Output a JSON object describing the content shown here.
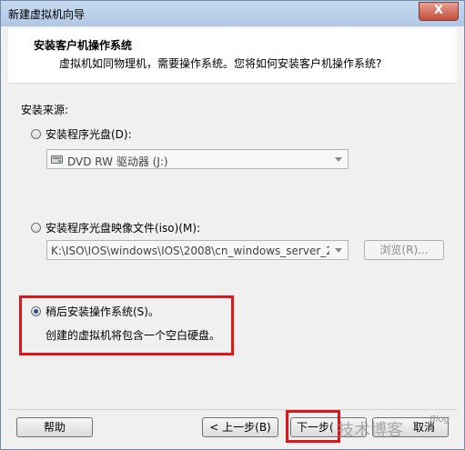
{
  "window": {
    "title": "新建虚拟机向导",
    "close_label": "X"
  },
  "header": {
    "title": "安装客户机操作系统",
    "subtitle": "虚拟机如同物理机，需要操作系统。您将如何安装客户机操作系统?"
  },
  "install_source": {
    "label": "安装来源:",
    "options": [
      {
        "label": "安装程序光盘(D):",
        "checked": false
      },
      {
        "label": "安装程序光盘映像文件(iso)(M):",
        "checked": false
      },
      {
        "label": "稍后安装操作系统(S)。",
        "checked": true
      }
    ],
    "disc_drive": "DVD RW 驱动器 (J:)",
    "iso_path": "K:\\ISO\\IOS\\windows\\IOS\\2008\\cn_windows_server_20(",
    "browse_label": "浏览(R)...",
    "later_description": "创建的虚拟机将包含一个空白硬盘。"
  },
  "footer": {
    "help_label": "帮助",
    "back_label": "< 上一步(B)",
    "next_label": "下一步(",
    "cancel_label": "取消"
  },
  "watermark": {
    "text": "技术博客",
    "small": "Blog"
  },
  "colors": {
    "highlight": "#e0151a",
    "titlebar": "#b9cde8"
  }
}
